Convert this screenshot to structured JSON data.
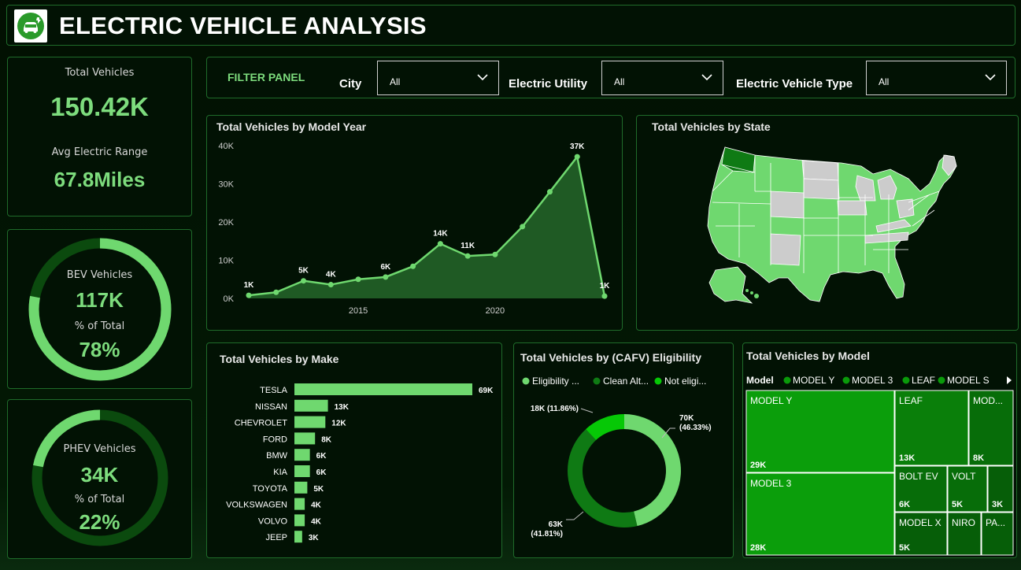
{
  "app": {
    "title": "ELECTRIC VEHICLE ANALYSIS"
  },
  "kpi": {
    "total_label": "Total Vehicles",
    "total_value": "150.42K",
    "range_label": "Avg Electric Range",
    "range_value": "67.8Miles"
  },
  "bev": {
    "label": "BEV Vehicles",
    "value": "117K",
    "pct_label": "% of Total",
    "pct": "78%",
    "fraction": 0.78
  },
  "phev": {
    "label": "PHEV Vehicles",
    "value": "34K",
    "pct_label": "% of Total",
    "pct": "22%",
    "fraction": 0.22
  },
  "filters": {
    "title": "FILTER PANEL",
    "city_label": "City",
    "city_value": "All",
    "utility_label": "Electric Utility",
    "utility_value": "All",
    "type_label": "Electric Vehicle Type",
    "type_value": "All"
  },
  "colors": {
    "accent": "#7ddc7d",
    "dark_green": "#0f6a14",
    "mid_green": "#13a413",
    "bright_green": "#06c806",
    "grey_state": "#cccccc"
  },
  "chart_data": [
    {
      "type": "area",
      "title": "Total Vehicles by Model Year",
      "xlabel": "",
      "ylabel": "",
      "x": [
        2011,
        2012,
        2013,
        2014,
        2015,
        2016,
        2017,
        2018,
        2019,
        2020,
        2021,
        2022,
        2023,
        2024
      ],
      "values": [
        800,
        1600,
        4600,
        3600,
        5000,
        5600,
        8400,
        14300,
        11100,
        11500,
        18800,
        27900,
        37100,
        600
      ],
      "data_labels": [
        {
          "x": 2011,
          "text": "1K"
        },
        {
          "x": 2013,
          "text": "5K"
        },
        {
          "x": 2014,
          "text": "4K"
        },
        {
          "x": 2016,
          "text": "6K"
        },
        {
          "x": 2018,
          "text": "14K"
        },
        {
          "x": 2019,
          "text": "11K"
        },
        {
          "x": 2023,
          "text": "37K"
        },
        {
          "x": 2024,
          "text": "1K"
        }
      ],
      "y_ticks": [
        "0K",
        "10K",
        "20K",
        "30K",
        "40K"
      ],
      "x_ticks": [
        "2015",
        "2020"
      ],
      "ylim": [
        0,
        40000
      ],
      "grid": false
    },
    {
      "type": "bar",
      "title": "Total Vehicles by Make",
      "categories": [
        "TESLA",
        "NISSAN",
        "CHEVROLET",
        "FORD",
        "BMW",
        "KIA",
        "TOYOTA",
        "VOLKSWAGEN",
        "VOLVO",
        "JEEP"
      ],
      "values": [
        69,
        13,
        12,
        8,
        6,
        6,
        5,
        4,
        4,
        3
      ],
      "labels": [
        "69K",
        "13K",
        "12K",
        "8K",
        "6K",
        "6K",
        "5K",
        "4K",
        "4K",
        "3K"
      ],
      "orientation": "horizontal"
    },
    {
      "type": "pie",
      "title": "Total Vehicles by (CAFV) Eligibility",
      "legend": [
        "Eligibility ...",
        "Clean Alt...",
        "Not eligi..."
      ],
      "slices": [
        {
          "name": "Eligibility ...",
          "value": 46.33,
          "label": "70K",
          "pct": "(46.33%)",
          "color": "#6fd86f"
        },
        {
          "name": "Clean Alt...",
          "value": 41.81,
          "label": "63K",
          "pct": "(41.81%)",
          "color": "#0f7a14"
        },
        {
          "name": "Not eligi...",
          "value": 11.86,
          "label": "18K",
          "pct": "(11.86%)",
          "color": "#06c806"
        }
      ]
    },
    {
      "type": "treemap",
      "title": "Total Vehicles by Model",
      "legend_title": "Model",
      "legend": [
        "MODEL Y",
        "MODEL 3",
        "LEAF",
        "MODEL S"
      ],
      "items": [
        {
          "name": "MODEL Y",
          "value": "29K"
        },
        {
          "name": "MODEL 3",
          "value": "28K"
        },
        {
          "name": "LEAF",
          "value": "13K"
        },
        {
          "name": "MOD...",
          "value": "8K"
        },
        {
          "name": "BOLT EV",
          "value": "6K"
        },
        {
          "name": "VOLT",
          "value": "5K"
        },
        {
          "name": "",
          "value": "3K"
        },
        {
          "name": "MODEL X",
          "value": "5K"
        },
        {
          "name": "NIRO",
          "value": ""
        },
        {
          "name": "PA...",
          "value": ""
        }
      ]
    }
  ],
  "map": {
    "title": "Total Vehicles by State"
  }
}
